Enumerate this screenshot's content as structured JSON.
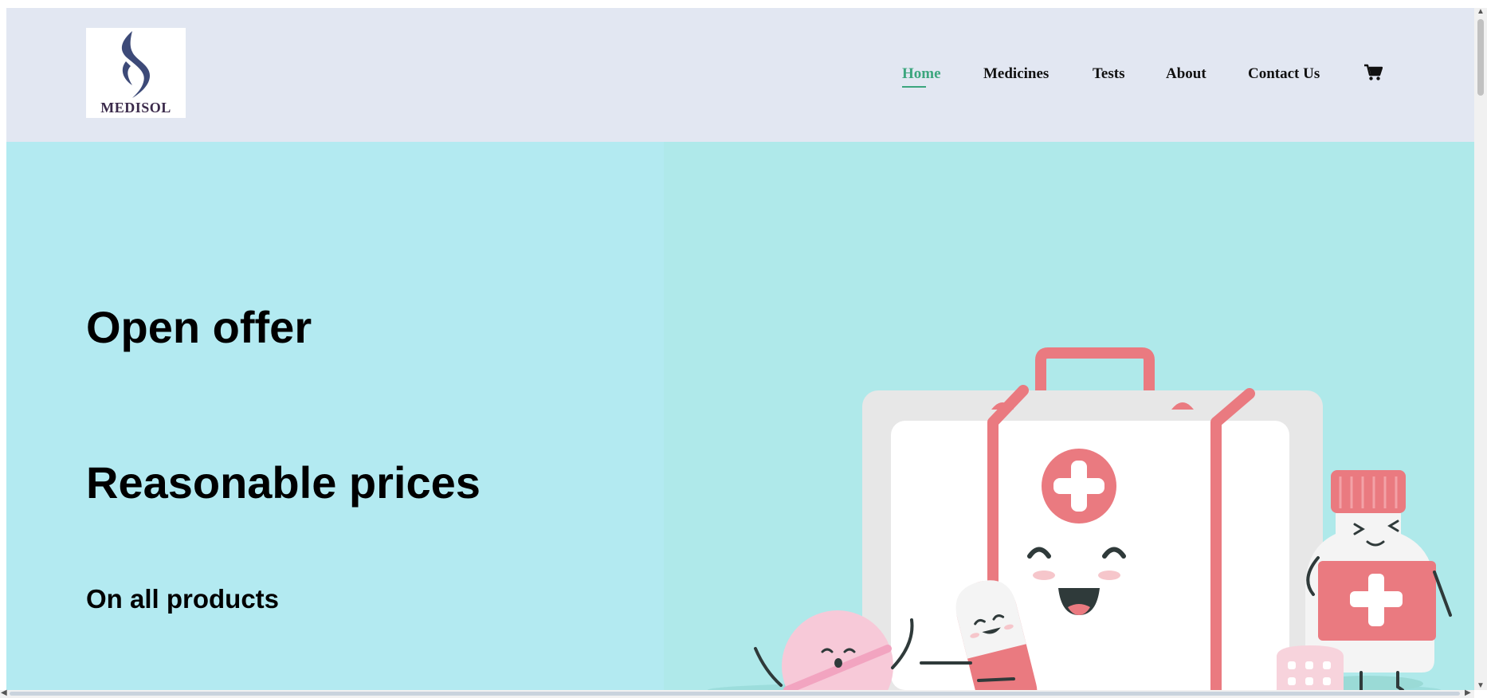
{
  "brand": {
    "logo_text": "MEDISOL"
  },
  "nav": {
    "items": [
      {
        "label": "Home",
        "active": true
      },
      {
        "label": "Medicines"
      },
      {
        "label": "Tests"
      },
      {
        "label": "About"
      },
      {
        "label": "Contact Us"
      }
    ],
    "cart_icon": "shopping-cart-icon"
  },
  "hero": {
    "headline_1": "Open offer",
    "headline_2": "Reasonable prices",
    "subheadline": "On all products",
    "illustration": "first-aid-kit-cartoon-illustration"
  },
  "colors": {
    "header_bg": "#e2e7f2",
    "hero_bg": "#b3eaf1",
    "accent_active": "#3ca67e",
    "kit_red": "#ea7a80"
  }
}
